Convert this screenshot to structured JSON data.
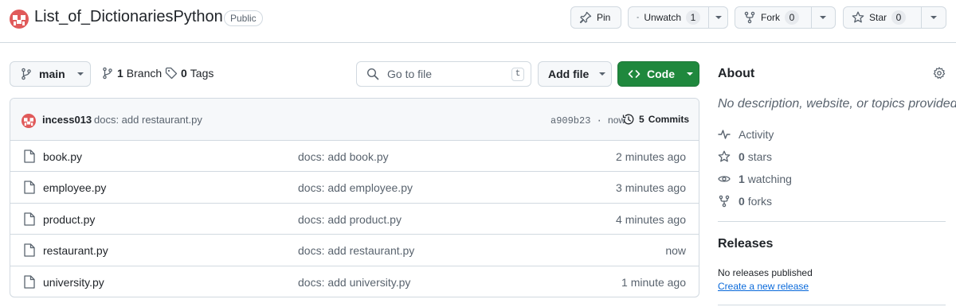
{
  "repo": {
    "name": "List_of_DictionariesPython",
    "visibility": "Public"
  },
  "header_actions": {
    "pin_label": "Pin",
    "watch_label": "Unwatch",
    "watch_count": "1",
    "fork_label": "Fork",
    "fork_count": "0",
    "star_label": "Star",
    "star_count": "0"
  },
  "toolbar": {
    "branch": "main",
    "branches_count": "1",
    "branches_label": "Branch",
    "tags_count": "0",
    "tags_label": "Tags",
    "search_placeholder": "Go to file",
    "search_shortcut": "t",
    "add_file_label": "Add file",
    "code_label": "Code"
  },
  "latest_commit": {
    "author": "incess013",
    "message": "docs: add restaurant.py",
    "hash": "a909b23",
    "separator": "·",
    "time": "now",
    "commits_count": "5",
    "commits_label": "Commits"
  },
  "files": [
    {
      "name": "book.py",
      "commit": "docs: add book.py",
      "time": "2 minutes ago"
    },
    {
      "name": "employee.py",
      "commit": "docs: add employee.py",
      "time": "3 minutes ago"
    },
    {
      "name": "product.py",
      "commit": "docs: add product.py",
      "time": "4 minutes ago"
    },
    {
      "name": "restaurant.py",
      "commit": "docs: add restaurant.py",
      "time": "now"
    },
    {
      "name": "university.py",
      "commit": "docs: add university.py",
      "time": "1 minute ago"
    }
  ],
  "about": {
    "title": "About",
    "description": "No description, website, or topics provided.",
    "activity_label": "Activity",
    "stars_count": "0",
    "stars_label": "stars",
    "watching_count": "1",
    "watching_label": "watching",
    "forks_count": "0",
    "forks_label": "forks"
  },
  "releases": {
    "title": "Releases",
    "none_text": "No releases published",
    "create_link": "Create a new release"
  },
  "colors": {
    "accent_green": "#1f883d",
    "link_blue": "#0969da",
    "avatar_red": "#e05a5a"
  }
}
